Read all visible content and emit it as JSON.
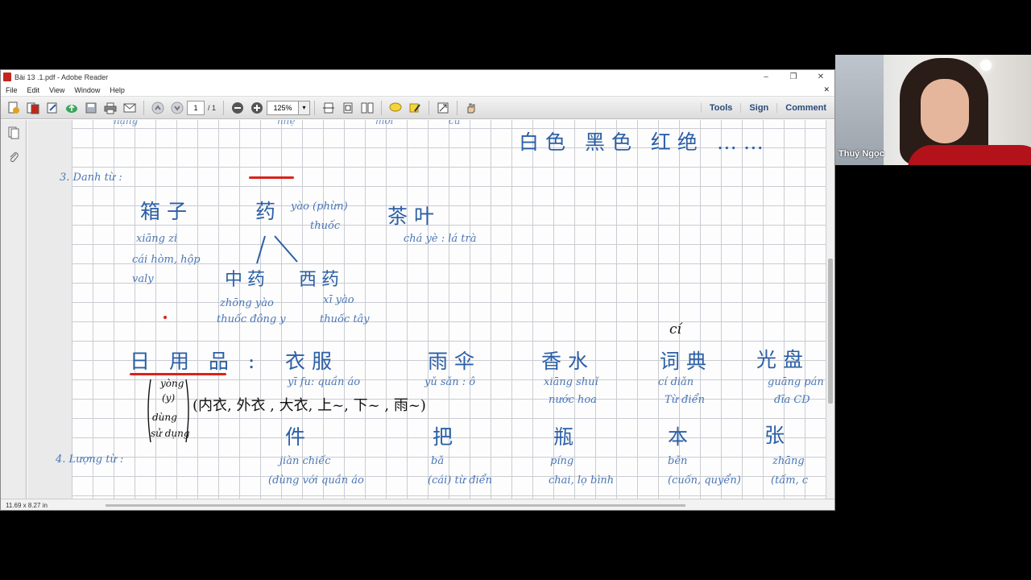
{
  "window": {
    "title": "Bài 13 .1.pdf - Adobe Reader",
    "minimize": "–",
    "restore": "❐",
    "close": "✕"
  },
  "menu": [
    "File",
    "Edit",
    "View",
    "Window",
    "Help"
  ],
  "menu_close_doc": "✕",
  "toolbar": {
    "page_current": "1",
    "page_total": "/ 1",
    "zoom": "125%",
    "zoom_dropdown": "▾",
    "links": [
      "Tools",
      "Sign",
      "Comment"
    ]
  },
  "statusbar": {
    "page_size": "11.69 x 8.27 in"
  },
  "webcam": {
    "participant_name": "Thuý Ngọc"
  },
  "notes": {
    "top_pinyin": [
      "nặng",
      "nhẹ",
      "mới",
      "cũ"
    ],
    "colors_line": "白色  黑色  红绝 ……",
    "section3": "3. Danh từ :",
    "section4": "4. Lượng từ :",
    "w_xiangzi": "箱子",
    "w_xiangzi_py": "xiāng zi",
    "w_xiangzi_vi1": "cái hòm, hộp",
    "w_xiangzi_vi2": "valy",
    "w_yao": "药",
    "w_yao_py": "yào (phừn)",
    "w_yao_vi": "thuốc",
    "w_chaye": "茶叶",
    "w_chaye_py": "chá yè : lá trà",
    "w_zhongyao": "中药",
    "w_zhongyao_py": "zhōng yào",
    "w_zhongyao_vi": "thuốc đông y",
    "w_xiyao": "西药",
    "w_xiyao_py": "xī yào",
    "w_xiyao_vi": "thuốc tây",
    "w_ci_top": "cí",
    "w_riyongpin": "日 用 品 :",
    "w_yong_note": [
      "yòng",
      "(y)",
      "dùng",
      "sử dụng"
    ],
    "w_clothes_note": "(内衣, 外衣 , 大衣, 上~, 下~ ,  雨~)",
    "w_yifu": "衣服",
    "w_yifu_py": "yī fu: quần áo",
    "w_yusan": "雨伞",
    "w_yusan_py": "yǔ sǎn : ô",
    "w_xiangshui": "香水",
    "w_xiangshui_py": "xiāng shuǐ",
    "w_xiangshui_vi": "nước hoa",
    "w_cidian": "词典",
    "w_cidian_py": "cí diǎn",
    "w_cidian_vi": "Từ điển",
    "w_guangpan": "光盘",
    "w_guangpan_py": "guāng pán",
    "w_guangpan_vi": "đĩa CD",
    "w_jian": "件",
    "w_jian_py": "jiàn  chiếc",
    "w_jian_vi": "(dùng với quần áo",
    "w_ba": "把",
    "w_ba_py": "bǎ",
    "w_ba_vi": "(cái) từ điển",
    "w_ping": "瓶",
    "w_ping_py": "píng",
    "w_ping_vi": "chai, lọ bình",
    "w_ben": "本",
    "w_ben_py": "běn",
    "w_ben_vi": "(cuốn, quyển)",
    "w_zhang": "张",
    "w_zhang_py": "zhāng",
    "w_zhang_vi": "(tấm, c"
  },
  "icons": {
    "create": "create-pdf-icon",
    "print": "print-icon",
    "email": "email-icon",
    "pages": "pages-panel-icon",
    "attachments": "paperclip-icon"
  }
}
